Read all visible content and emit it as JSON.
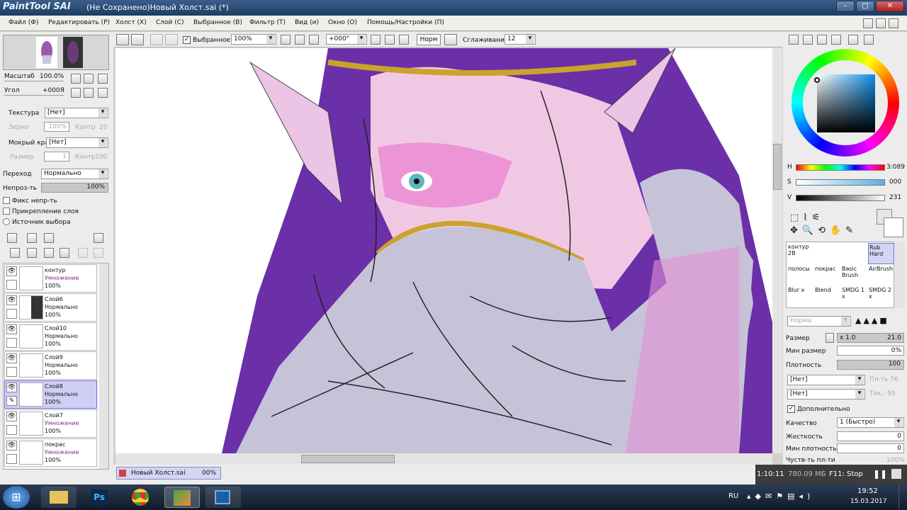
{
  "window": {
    "app_logo": "PaintTool SAI",
    "title": "(Не Сохранено)Новый Холст.sai (*)"
  },
  "menu": [
    "Файл (Ф)",
    "Редактировать (Р)",
    "Холст (Х)",
    "Слой (С)",
    "Выбранное (В)",
    "Фильтр (Т)",
    "Вид (и)",
    "Окно (О)",
    "Помощь/Настройки (П)"
  ],
  "nav": {
    "scale_label": "Масштаб",
    "scale_value": "100.0%",
    "angle_label": "Угол",
    "angle_value": "+000Я"
  },
  "texture": {
    "texture_label": "Текстура",
    "texture_value": "[Нет]",
    "grain_label": "Зерно",
    "grain_value": "100%",
    "contrast_label": "Контр",
    "contrast_value": "20",
    "wet_label": "Мокрый край",
    "wet_value": "[Нет]",
    "size_label": "Размер",
    "size_value": "1",
    "contrast2_label": "Контр",
    "contrast2_value": "100"
  },
  "blend": {
    "label": "Переход",
    "value": "Нормально",
    "opacity_label": "Непроз-ть",
    "opacity_value": "100%"
  },
  "checks": [
    "Фикс непр-ть",
    "Прикрепление слоя",
    "Источник выбора"
  ],
  "layers": [
    {
      "name": "контур",
      "mode": "Умножение",
      "opacity": "100%",
      "selected": false,
      "mode_color": "#8a2a8a"
    },
    {
      "name": "Слой6",
      "mode": "Нормально",
      "opacity": "100%",
      "selected": false,
      "mode_color": "#111"
    },
    {
      "name": "Слой10",
      "mode": "Нормально",
      "opacity": "100%",
      "selected": false,
      "mode_color": "#111"
    },
    {
      "name": "Слой9",
      "mode": "Нормально",
      "opacity": "100%",
      "selected": false,
      "mode_color": "#111"
    },
    {
      "name": "Слой8",
      "mode": "Нормально",
      "opacity": "100%",
      "selected": true,
      "mode_color": "#111"
    },
    {
      "name": "Слой7",
      "mode": "Умножение",
      "opacity": "100%",
      "selected": false,
      "mode_color": "#8a2a8a"
    },
    {
      "name": "покрас",
      "mode": "Умножение",
      "opacity": "100%",
      "selected": false,
      "mode_color": "#8a2a8a"
    }
  ],
  "toolbar": {
    "selection_label": "Выбранное",
    "zoom": "100%",
    "rotation": "+000°",
    "blend_mode": "Норм",
    "smoothing_label": "Сглаживание",
    "smoothing_value": "12"
  },
  "doc_tab": {
    "name": "Новый Холст.sai",
    "percent": "00%"
  },
  "color": {
    "h_label": "H",
    "h_value": "3:089",
    "s_label": "S",
    "s_value": "000",
    "v_label": "V",
    "v_value": "231"
  },
  "brushes": [
    {
      "name": "контур 2В"
    },
    {
      "name": ""
    },
    {
      "name": ""
    },
    {
      "name": "Rub Hard"
    },
    {
      "name": "полосы"
    },
    {
      "name": "покрас"
    },
    {
      "name": "Basic Brush"
    },
    {
      "name": "AirBrush"
    },
    {
      "name": "Blur x"
    },
    {
      "name": "Blend"
    },
    {
      "name": "SMDG 1 x"
    },
    {
      "name": "SMDG 2 x"
    }
  ],
  "brush_settings": {
    "mode": "Норма",
    "size_label": "Размер",
    "size_mult": "x 1.0",
    "size_value": "21.0",
    "min_size_label": "Мин размер",
    "min_size_value": "0%",
    "density_label": "Плотность",
    "density_value": "100",
    "tex1": "[Нет]",
    "tex1_val": "Пл-ть 76",
    "tex2": "[Нет]",
    "tex2_val": "Тек.: 95",
    "advanced_label": "Дополнительно",
    "quality_label": "Качество",
    "quality_value": "1 (Быстро)",
    "hardness_label": "Жесткость",
    "hardness_value": "0",
    "min_density_label": "Мин плотность",
    "min_density_value": "0",
    "sensitivity_label": "Чуств-ть пл-ти",
    "sensitivity_value": "100%"
  },
  "recording": {
    "time": "1:10:11",
    "size": "780.09 МБ",
    "hotkey": "F11: Stop"
  },
  "taskbar": {
    "lang": "RU",
    "time": "19:52",
    "date": "15.03.2017"
  }
}
